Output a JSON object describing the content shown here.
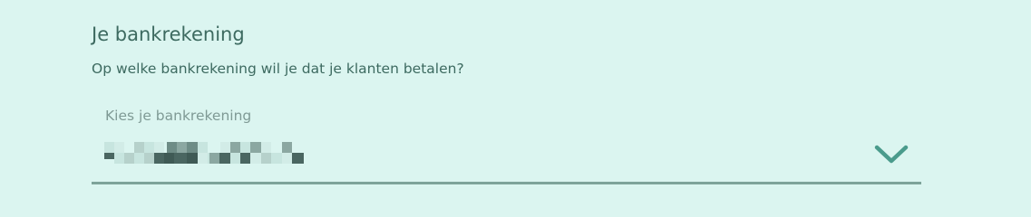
{
  "bank_section": {
    "title": "Je bankrekening",
    "description": "Op welke bankrekening wil je dat je klanten betalen?",
    "select": {
      "label": "Kies je bankrekening",
      "value_obscured": true,
      "chevron_icon": "chevron-down-icon"
    }
  },
  "colors": {
    "background": "#dbf5f0",
    "text": "#3d6a60",
    "label": "#7f9a95",
    "accent": "#4a9b8c",
    "underline": "#7ea39a"
  }
}
